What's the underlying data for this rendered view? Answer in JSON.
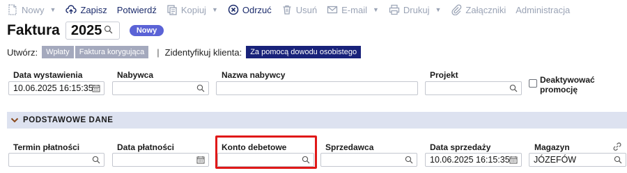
{
  "toolbar": {
    "new_label": "Nowy",
    "save_label": "Zapisz",
    "confirm_label": "Potwierdź",
    "copy_label": "Kopiuj",
    "reject_label": "Odrzuć",
    "delete_label": "Usuń",
    "email_label": "E-mail",
    "print_label": "Drukuj",
    "attachments_label": "Załączniki",
    "admin_label": "Administracja"
  },
  "header": {
    "title": "Faktura",
    "year": "2025",
    "status_badge": "Nowy"
  },
  "create": {
    "label": "Utwórz:",
    "payments_label": "Wpłaty",
    "correction_label": "Faktura korygująca",
    "identify_label": "Zidentyfikuj klienta:",
    "id_doc_label": "Za pomocą dowodu osobistego"
  },
  "fields": {
    "issue_date": {
      "label": "Data wystawienia",
      "value": "10.06.2025 16:15:35"
    },
    "buyer": {
      "label": "Nabywca",
      "value": ""
    },
    "buyer_name": {
      "label": "Nazwa nabywcy",
      "value": ""
    },
    "project": {
      "label": "Projekt",
      "value": ""
    },
    "deactivate": {
      "label_line1": "Deaktywować",
      "label_line2": "promocję",
      "checked": false
    }
  },
  "section": {
    "title": "PODSTAWOWE DANE"
  },
  "basic": {
    "payment_term": {
      "label": "Termin płatności",
      "value": ""
    },
    "payment_date": {
      "label": "Data płatności",
      "value": ""
    },
    "debit_account": {
      "label": "Konto debetowe",
      "value": ""
    },
    "seller": {
      "label": "Sprzedawca",
      "value": ""
    },
    "sale_date": {
      "label": "Data sprzedaży",
      "value": "10.06.2025 16:15:35"
    },
    "warehouse": {
      "label": "Magazyn",
      "value": "JÓZEFÓW"
    }
  },
  "colors": {
    "accent_navy": "#1b2b6b",
    "disabled": "#9aa3b5",
    "badge": "#5b63d6",
    "section_bg": "#dde2f0",
    "highlight": "#e01818"
  }
}
